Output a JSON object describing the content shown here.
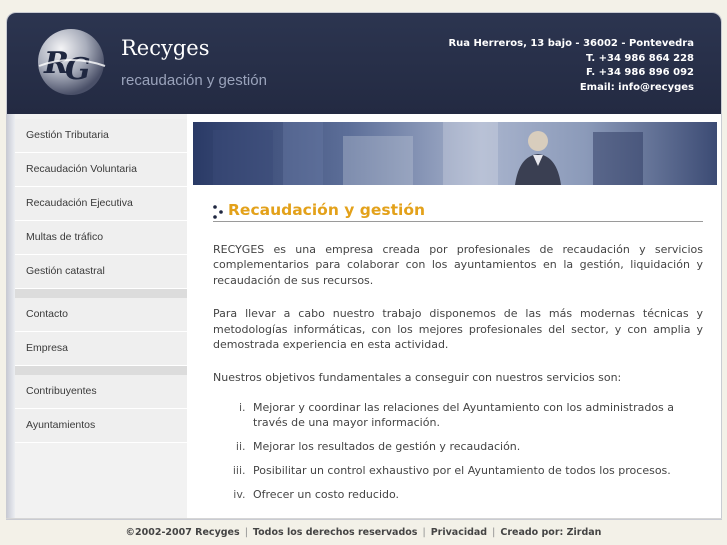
{
  "header": {
    "brand": "Recyges",
    "tagline": "recaudación y gestión",
    "address": "Rua Herreros, 13 bajo - 36002 - Pontevedra",
    "phone": "T. +34 986 864 228",
    "fax": "F. +34 986 896 092",
    "email": "Email: info@recyges"
  },
  "sidebar": {
    "group1": [
      "Gestión Tributaria",
      "Recaudación Voluntaria",
      "Recaudación Ejecutiva",
      "Multas de tráfico",
      "Gestión catastral"
    ],
    "group2": [
      "Contacto",
      "Empresa"
    ],
    "group3": [
      "Contribuyentes",
      "Ayuntamientos"
    ]
  },
  "content": {
    "title": "Recaudación y gestión",
    "p1": "RECYGES es una empresa creada por profesionales de recaudación y servicios complementarios para colaborar con los ayuntamientos en la gestión, liquidación y recaudación de sus recursos.",
    "p2": "Para llevar a cabo nuestro trabajo disponemos de las más modernas técnicas y metodologías informáticas, con los mejores profesionales del sector, y con amplia y demostrada experiencia en esta actividad.",
    "p3": "Nuestros objetivos fundamentales a conseguir con nuestros servicios son:",
    "objectives": [
      "Mejorar y coordinar las relaciones del Ayuntamiento con los administrados a través de una mayor información.",
      "Mejorar los resultados de gestión y recaudación.",
      "Posibilitar un control exhaustivo por el Ayuntamiento de todos los procesos.",
      "Ofrecer un costo reducido."
    ]
  },
  "footer": {
    "copyright": "©2002-2007 Recyges",
    "rights": "Todos los derechos reservados",
    "privacy": "Privacidad",
    "credit": "Creado por: Zirdan"
  },
  "colors": {
    "header_bg": "#262d46",
    "accent": "#e3a11a"
  },
  "icons": {
    "logo": "rg-logo",
    "banner": "business-person-banner",
    "heading_bullets": "dots-bullet-icon"
  }
}
